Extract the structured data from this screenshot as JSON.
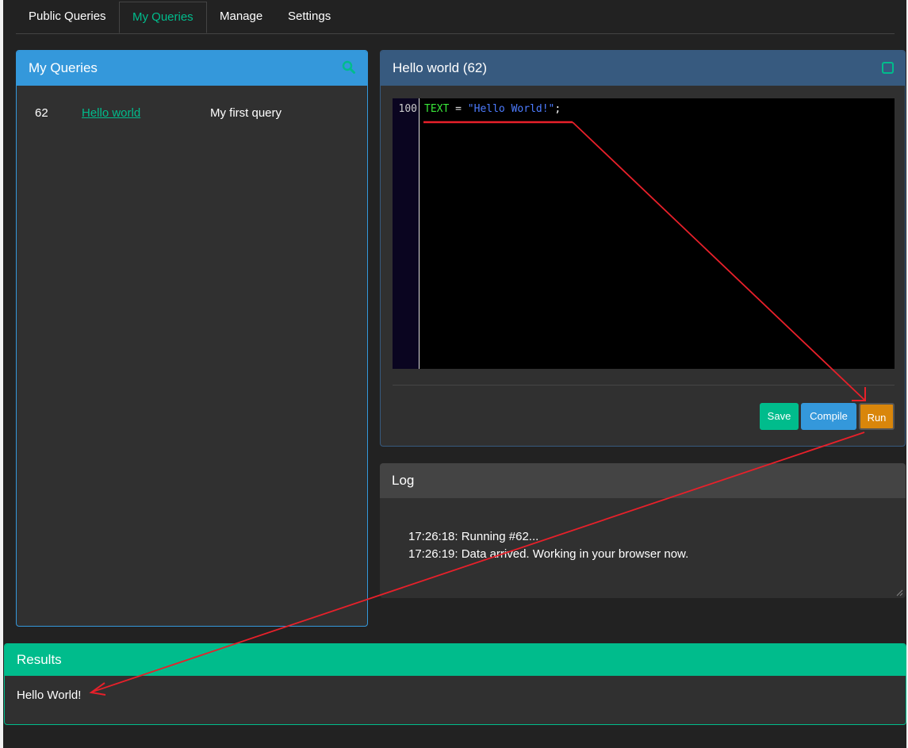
{
  "tabs": [
    {
      "label": "Public Queries"
    },
    {
      "label": "My Queries"
    },
    {
      "label": "Manage"
    },
    {
      "label": "Settings"
    }
  ],
  "my_queries": {
    "title": "My Queries",
    "rows": [
      {
        "id": "62",
        "name": "Hello world",
        "description": "My first query"
      }
    ]
  },
  "editor": {
    "title": "Hello world (62)",
    "line_number": "100",
    "code": {
      "var": "TEXT",
      "op": " = ",
      "str": "\"Hello World!\"",
      "punc": ";"
    },
    "save_label": "Save",
    "compile_label": "Compile",
    "run_label": "Run"
  },
  "log": {
    "title": "Log",
    "lines": [
      "17:26:18: Running #62...",
      "17:26:19: Data arrived. Working in your browser now."
    ]
  },
  "results": {
    "title": "Results",
    "text": "Hello World!"
  },
  "colors": {
    "accent": "#00bc8c",
    "primary": "#3498db",
    "editor_header": "#375a7f",
    "run": "#d9860b",
    "annotation": "#e8202a"
  }
}
